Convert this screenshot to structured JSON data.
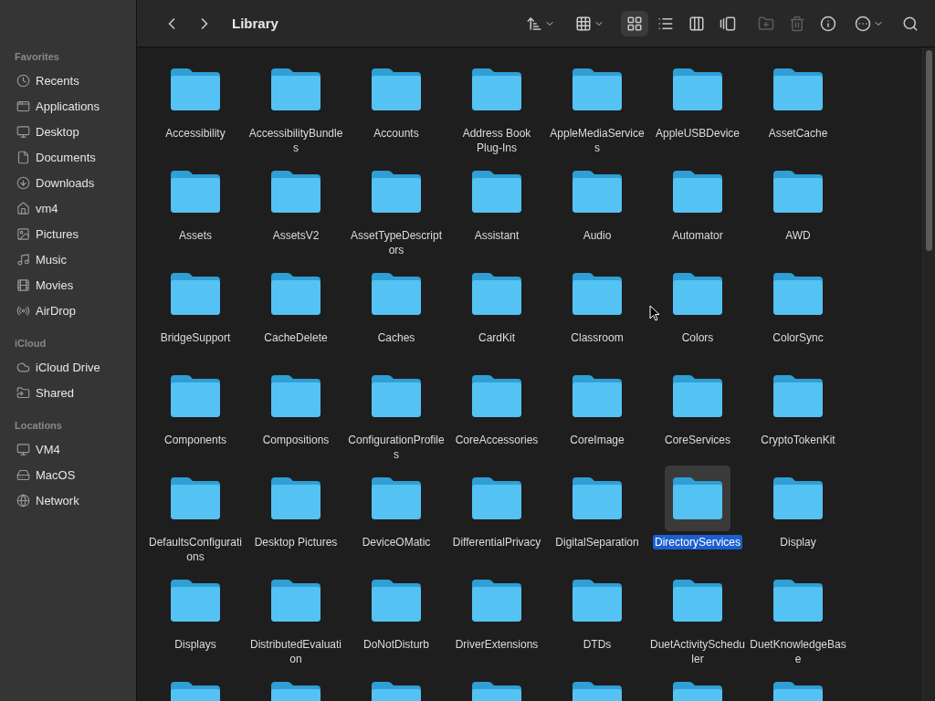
{
  "sidebar": {
    "sections": [
      {
        "heading": "Favorites",
        "items": [
          {
            "label": "Recents"
          },
          {
            "label": "Applications"
          },
          {
            "label": "Desktop"
          },
          {
            "label": "Documents"
          },
          {
            "label": "Downloads"
          },
          {
            "label": "vm4"
          },
          {
            "label": "Pictures"
          },
          {
            "label": "Music"
          },
          {
            "label": "Movies"
          },
          {
            "label": "AirDrop"
          }
        ]
      },
      {
        "heading": "iCloud",
        "items": [
          {
            "label": "iCloud Drive"
          },
          {
            "label": "Shared"
          }
        ]
      },
      {
        "heading": "Locations",
        "items": [
          {
            "label": "VM4"
          },
          {
            "label": "MacOS"
          },
          {
            "label": "Network"
          }
        ]
      }
    ]
  },
  "toolbar": {
    "title": "Library",
    "view_modes": [
      {
        "selected": true
      },
      {
        "selected": false
      },
      {
        "selected": false
      },
      {
        "selected": false
      }
    ],
    "actions": [
      {
        "disabled": true
      },
      {
        "disabled": true
      },
      {
        "disabled": false
      }
    ]
  },
  "folders": [
    {
      "kind": "folder",
      "name": "Accessibility",
      "selected": false
    },
    {
      "kind": "folder",
      "name": "AccessibilityBundles",
      "selected": false
    },
    {
      "kind": "folder",
      "name": "Accounts",
      "selected": false
    },
    {
      "kind": "folder",
      "name": "Address Book Plug-Ins",
      "selected": false
    },
    {
      "kind": "folder",
      "name": "AppleMediaServices",
      "selected": false
    },
    {
      "kind": "folder",
      "name": "AppleUSBDevice",
      "selected": false
    },
    {
      "kind": "folder",
      "name": "AssetCache",
      "selected": false
    },
    {
      "kind": "folder",
      "name": "Assets",
      "selected": false
    },
    {
      "kind": "folder",
      "name": "AssetsV2",
      "selected": false
    },
    {
      "kind": "folder",
      "name": "AssetTypeDescriptors",
      "selected": false
    },
    {
      "kind": "folder",
      "name": "Assistant",
      "selected": false
    },
    {
      "kind": "folder",
      "name": "Audio",
      "selected": false
    },
    {
      "kind": "folder",
      "name": "Automator",
      "selected": false
    },
    {
      "kind": "folder",
      "name": "AWD",
      "selected": false
    },
    {
      "kind": "folder",
      "name": "BridgeSupport",
      "selected": false
    },
    {
      "kind": "folder",
      "name": "CacheDelete",
      "selected": false
    },
    {
      "kind": "folder",
      "name": "Caches",
      "selected": false
    },
    {
      "kind": "folder",
      "name": "CardKit",
      "selected": false
    },
    {
      "kind": "folder",
      "name": "Classroom",
      "selected": false
    },
    {
      "kind": "folder",
      "name": "Colors",
      "selected": false
    },
    {
      "kind": "folder",
      "name": "ColorSync",
      "selected": false
    },
    {
      "kind": "folder",
      "name": "Components",
      "selected": false
    },
    {
      "kind": "folder",
      "name": "Compositions",
      "selected": false
    },
    {
      "kind": "folder",
      "name": "ConfigurationProfiles",
      "selected": false
    },
    {
      "kind": "folder",
      "name": "CoreAccessories",
      "selected": false
    },
    {
      "kind": "folder",
      "name": "CoreImage",
      "selected": false
    },
    {
      "kind": "folder",
      "name": "CoreServices",
      "selected": false
    },
    {
      "kind": "folder",
      "name": "CryptoTokenKit",
      "selected": false
    },
    {
      "kind": "folder",
      "name": "DefaultsConfigurations",
      "selected": false
    },
    {
      "kind": "folder",
      "name": "Desktop Pictures",
      "selected": false
    },
    {
      "kind": "folder",
      "name": "DeviceOMatic",
      "selected": false
    },
    {
      "kind": "folder",
      "name": "DifferentialPrivacy",
      "selected": false
    },
    {
      "kind": "folder",
      "name": "DigitalSeparation",
      "selected": false
    },
    {
      "kind": "folder",
      "name": "DirectoryServices",
      "selected": true
    },
    {
      "kind": "folder",
      "name": "Display",
      "selected": false
    },
    {
      "kind": "folder",
      "name": "Displays",
      "selected": false
    },
    {
      "kind": "folder",
      "name": "DistributedEvaluation",
      "selected": false
    },
    {
      "kind": "folder",
      "name": "DoNotDisturb",
      "selected": false
    },
    {
      "kind": "folder",
      "name": "DriverExtensions",
      "selected": false
    },
    {
      "kind": "folder",
      "name": "DTDs",
      "selected": false
    },
    {
      "kind": "folder",
      "name": "DuetActivityScheduler",
      "selected": false
    },
    {
      "kind": "folder",
      "name": "DuetKnowledgeBase",
      "selected": false
    },
    {
      "kind": "folder"
    },
    {
      "kind": "folder"
    },
    {
      "kind": "folder"
    },
    {
      "kind": "folder"
    },
    {
      "kind": "folder"
    },
    {
      "kind": "folder"
    },
    {
      "kind": "folder"
    }
  ]
}
